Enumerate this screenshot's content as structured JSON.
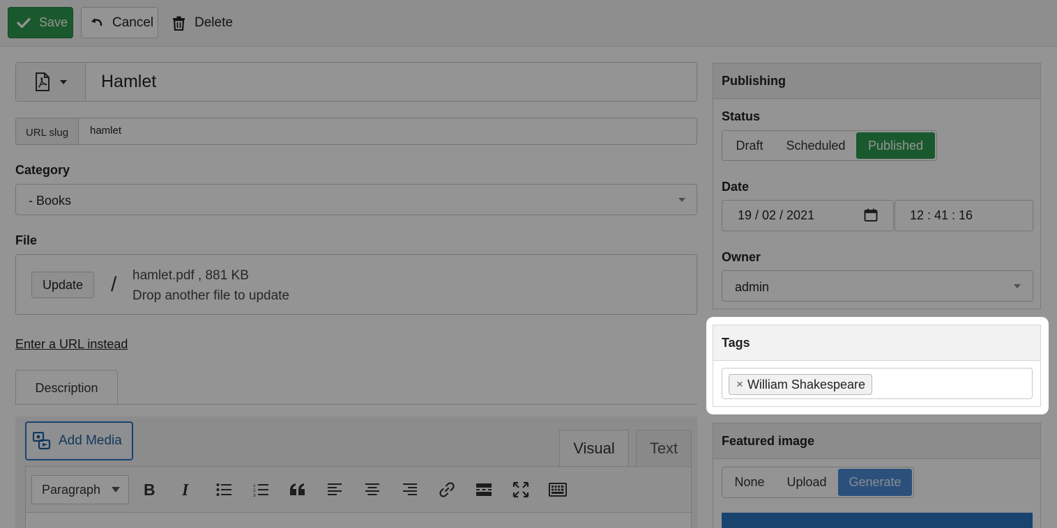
{
  "toolbar": {
    "save_label": "Save",
    "cancel_label": "Cancel",
    "delete_label": "Delete"
  },
  "title": {
    "value": "Hamlet"
  },
  "slug": {
    "label": "URL slug",
    "value": "hamlet"
  },
  "category": {
    "label": "Category",
    "value": "- Books"
  },
  "file": {
    "label": "File",
    "update_label": "Update",
    "separator": "/",
    "name": "hamlet.pdf , 881 KB",
    "hint": "Drop another file to update",
    "url_link": "Enter a URL instead"
  },
  "description": {
    "tab_label": "Description",
    "add_media_label": "Add Media",
    "tab_visual": "Visual",
    "tab_text": "Text",
    "format_value": "Paragraph"
  },
  "publishing": {
    "heading": "Publishing",
    "status_label": "Status",
    "status_options": [
      "Draft",
      "Scheduled",
      "Published"
    ],
    "status_selected": "Published",
    "date_label": "Date",
    "date_value": "19 / 02 / 2021",
    "time_value": "12 : 41 : 16",
    "owner_label": "Owner",
    "owner_value": "admin"
  },
  "tags": {
    "heading": "Tags",
    "remove_symbol": "×",
    "items": [
      "William Shakespeare"
    ]
  },
  "featured_image": {
    "heading": "Featured image",
    "options": [
      "None",
      "Upload",
      "Generate"
    ],
    "selected": "Generate"
  },
  "colors": {
    "save": "#2e9a4e",
    "published": "#2e9a4e",
    "generate": "#4a8bd6",
    "add_media": "#2a74c1"
  }
}
